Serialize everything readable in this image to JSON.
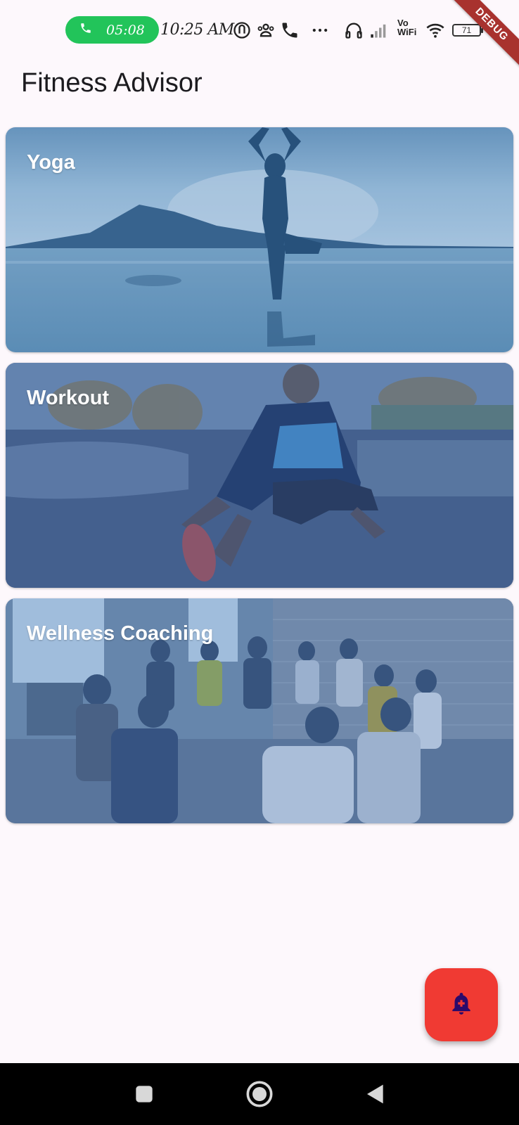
{
  "status_bar": {
    "call_time": "05:08",
    "clock": "10:25 AM",
    "vowifi_line1": "Vo",
    "vowifi_line2": "WiFi",
    "battery": "71",
    "debug_label": "DEBUG",
    "icons": [
      "phone-icon",
      "nfc-icon",
      "group-icon",
      "phone-icon",
      "more-icon",
      "headphones-icon",
      "signal-icon",
      "wifi-icon",
      "battery-icon"
    ]
  },
  "app_bar": {
    "title": "Fitness Advisor"
  },
  "cards": [
    {
      "title": "Yoga"
    },
    {
      "title": "Workout"
    },
    {
      "title": "Wellness Coaching"
    }
  ],
  "fab": {
    "icon": "notification-add-icon",
    "color": "#f03a33"
  },
  "nav": {
    "icons": [
      "recents-icon",
      "home-icon",
      "back-icon"
    ]
  },
  "colors": {
    "background": "#fdf8fc",
    "call_pill": "#22c45a",
    "debug": "#a8322e"
  }
}
